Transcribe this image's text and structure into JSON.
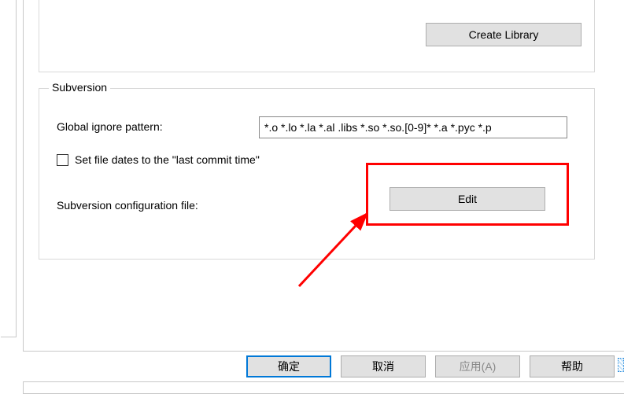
{
  "library": {
    "create_button": "Create Library"
  },
  "subversion": {
    "legend": "Subversion",
    "ignore_label": "Global ignore pattern:",
    "ignore_value": "*.o *.lo *.la *.al .libs *.so *.so.[0-9]* *.a *.pyc *.p",
    "last_commit_checkbox_label": "Set file dates to the \"last commit time\"",
    "last_commit_checked": false,
    "config_label": "Subversion configuration file:",
    "edit_button": "Edit"
  },
  "footer": {
    "ok": "确定",
    "cancel": "取消",
    "apply": "应用(A)",
    "help": "帮助"
  }
}
